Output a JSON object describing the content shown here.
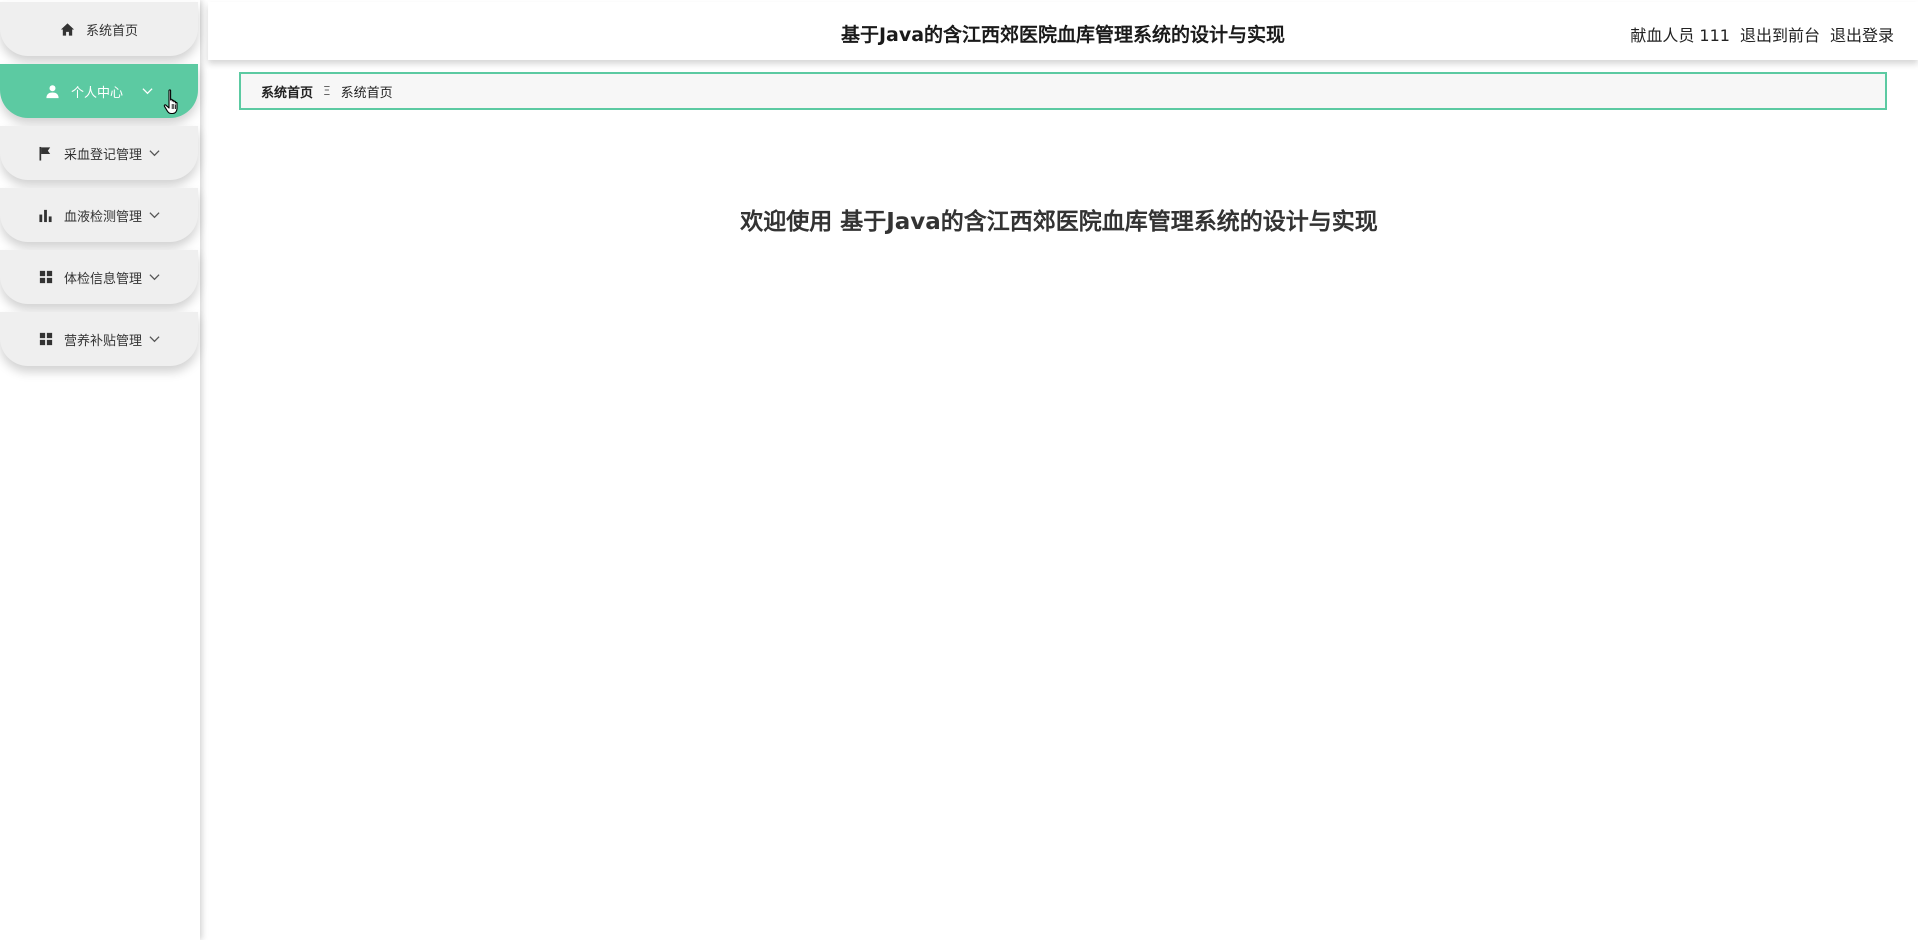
{
  "header": {
    "title": "基于Java的含江西郊医院血库管理系统的设计与实现",
    "user_label": "献血人员 111",
    "front_link": "退出到前台",
    "logout_link": "退出登录"
  },
  "sidebar": {
    "items": [
      {
        "label": "系统首页",
        "icon": "home-icon"
      },
      {
        "label": "个人中心",
        "icon": "user-icon"
      },
      {
        "label": "采血登记管理",
        "icon": "flag-icon"
      },
      {
        "label": "血液检测管理",
        "icon": "bar-chart-icon"
      },
      {
        "label": "体检信息管理",
        "icon": "grid-icon"
      },
      {
        "label": "营养补贴管理",
        "icon": "grid-icon"
      }
    ]
  },
  "breadcrumb": {
    "home": "系统首页",
    "separator": "Ξ",
    "current": "系统首页"
  },
  "main": {
    "welcome": "欢迎使用 基于Java的含江西郊医院血库管理系统的设计与实现"
  },
  "colors": {
    "accent": "#5ccaa2",
    "menu_bg": "#efefef",
    "text": "#333333"
  }
}
